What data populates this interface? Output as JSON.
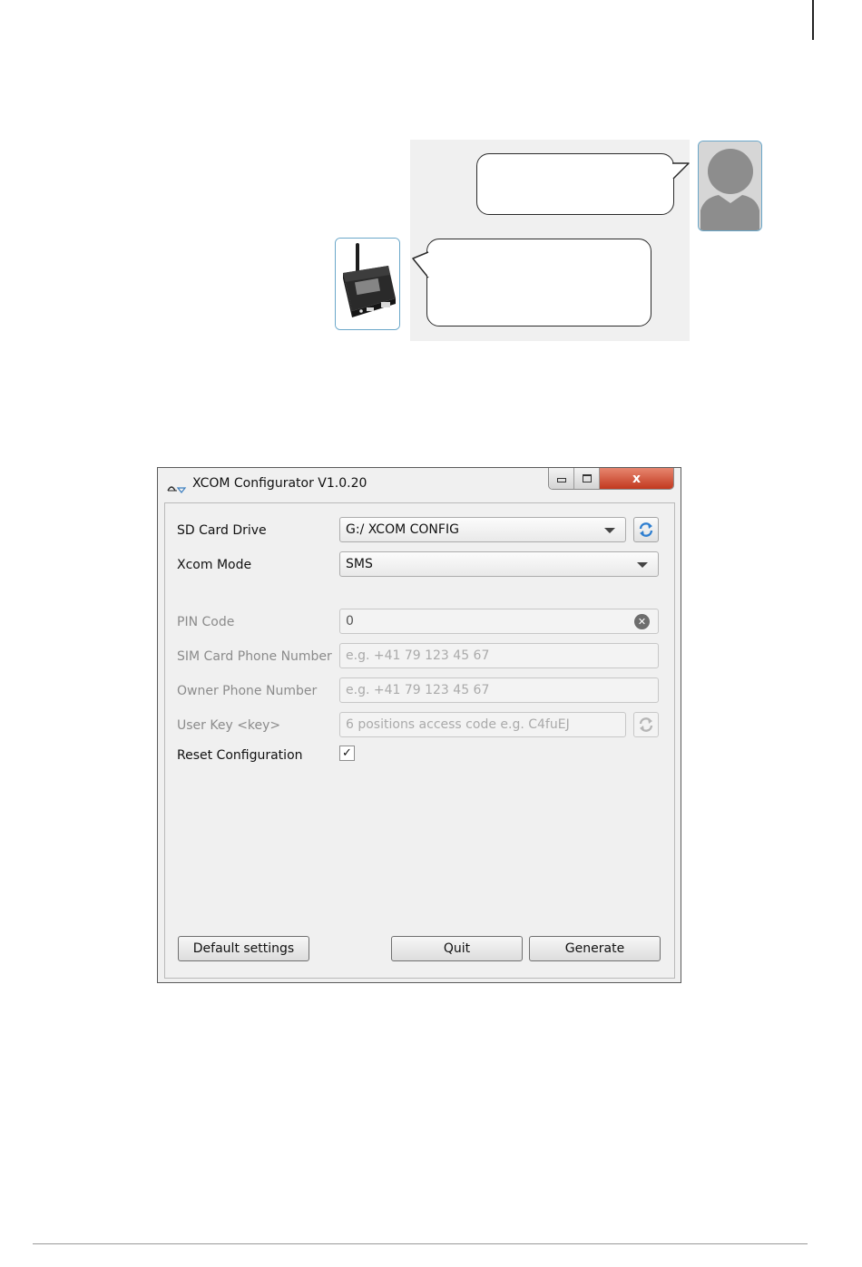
{
  "window": {
    "title": "XCOM Configurator V1.0.20",
    "controls": {
      "minimize_icon": "minimize-icon",
      "maximize_icon": "maximize-icon",
      "close_label": "x"
    }
  },
  "form": {
    "sd_card_drive": {
      "label": "SD Card Drive",
      "value": "G:/ XCOM CONFIG"
    },
    "xcom_mode": {
      "label": "Xcom Mode",
      "value": "SMS"
    },
    "pin_code": {
      "label": "PIN Code",
      "value": "0"
    },
    "sim_phone": {
      "label": "SIM Card Phone Number",
      "placeholder": "e.g. +41 79 123 45 67"
    },
    "owner_phone": {
      "label": "Owner Phone Number",
      "placeholder": "e.g. +41 79 123 45 67"
    },
    "user_key": {
      "label": "User Key <key>",
      "placeholder": "6 positions access code e.g. C4fuEJ"
    },
    "reset_configuration": {
      "label": "Reset Configuration",
      "checked": true,
      "mark": "✓"
    }
  },
  "buttons": {
    "default_settings": "Default settings",
    "quit": "Quit",
    "generate": "Generate"
  },
  "icons": {
    "refresh": "refresh-icon",
    "clear": "clear-icon",
    "dropdown": "chevron-down-icon",
    "user_avatar": "user-avatar-icon",
    "device": "xcom-device-image"
  },
  "colors": {
    "refresh_blue": "#2f7fd0",
    "close_red": "#c94a2e",
    "frame_blue": "#6aa7c9"
  }
}
